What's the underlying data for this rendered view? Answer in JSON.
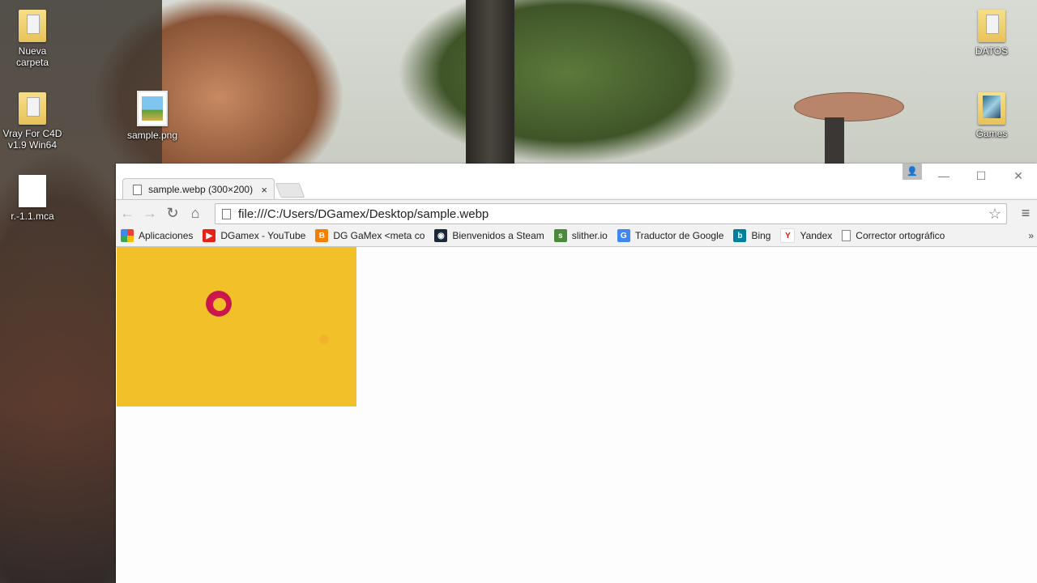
{
  "desktop": {
    "icons": [
      {
        "label": "Nueva\ncarpeta",
        "icon": "folder-icon"
      },
      {
        "label": "Vray For C4D\nv1.9 Win64",
        "icon": "folder-icon"
      },
      {
        "label": "sample.png",
        "icon": "image-file-icon"
      },
      {
        "label": "r.-1.1.mca",
        "icon": "file-icon"
      },
      {
        "label": "DATOS",
        "icon": "folder-icon"
      },
      {
        "label": "Games",
        "icon": "folder-icon"
      }
    ]
  },
  "browser": {
    "tab": {
      "title": "sample.webp (300×200)",
      "close": "×"
    },
    "window_controls": {
      "minimize": "—",
      "maximize": "☐",
      "close": "✕"
    },
    "user_badge": "👤",
    "nav": {
      "back": "←",
      "forward": "→",
      "reload": "↻",
      "home": "⌂"
    },
    "address": "file:///C:/Users/DGamex/Desktop/sample.webp",
    "star": "☆",
    "menu": "≡",
    "bookmarks": [
      {
        "label": "Aplicaciones",
        "icon": "apps-icon",
        "color": "#e94235"
      },
      {
        "label": "DGamex - YouTube",
        "icon": "youtube-icon",
        "color": "#e62117"
      },
      {
        "label": "DG GaMex <meta co",
        "icon": "blogger-icon",
        "color": "#f57d00"
      },
      {
        "label": "Bienvenidos a Steam",
        "icon": "steam-icon",
        "color": "#1b2838"
      },
      {
        "label": "slither.io",
        "icon": "slither-icon",
        "color": "#4a8a3a"
      },
      {
        "label": "Traductor de Google",
        "icon": "google-translate-icon",
        "color": "#4285f4"
      },
      {
        "label": "Bing",
        "icon": "bing-icon",
        "color": "#00809d"
      },
      {
        "label": "Yandex",
        "icon": "yandex-icon",
        "color": "#e61400"
      },
      {
        "label": "Corrector ortográfico",
        "icon": "page-icon",
        "color": "#888888"
      }
    ],
    "bookmarks_more": "»"
  }
}
